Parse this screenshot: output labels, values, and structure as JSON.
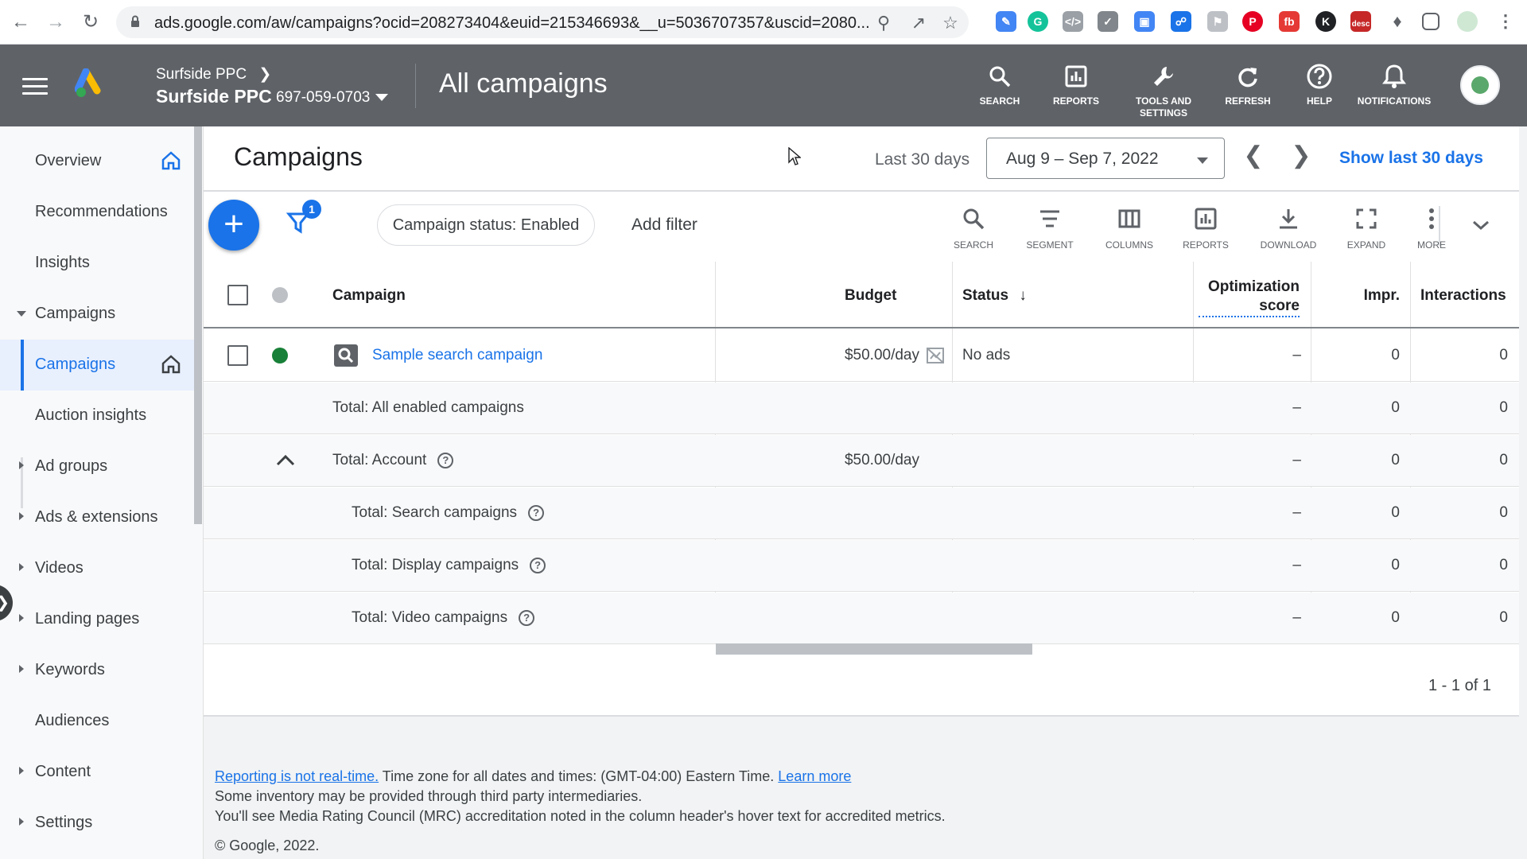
{
  "browser": {
    "url": "ads.google.com/aw/campaigns?ocid=208273404&euid=215346693&__u=5036707357&uscid=2080...",
    "extension_badge": "desc"
  },
  "header": {
    "account_breadcrumb": "Surfside PPC",
    "account_name": "Surfside PPC",
    "account_id": "697-059-0703",
    "page_title": "All campaigns",
    "tools": [
      {
        "icon": "search-icon",
        "label": "SEARCH"
      },
      {
        "icon": "reports-icon",
        "label": "REPORTS"
      },
      {
        "icon": "wrench-icon",
        "label": "TOOLS AND SETTINGS"
      },
      {
        "icon": "refresh-icon",
        "label": "REFRESH"
      },
      {
        "icon": "help-icon",
        "label": "HELP"
      },
      {
        "icon": "bell-icon",
        "label": "NOTIFICATIONS"
      }
    ]
  },
  "sidebar": {
    "items": [
      {
        "label": "Overview"
      },
      {
        "label": "Recommendations"
      },
      {
        "label": "Insights"
      },
      {
        "label": "Campaigns"
      },
      {
        "label": "Campaigns"
      },
      {
        "label": "Auction insights"
      },
      {
        "label": "Ad groups"
      },
      {
        "label": "Ads & extensions"
      },
      {
        "label": "Videos"
      },
      {
        "label": "Landing pages"
      },
      {
        "label": "Keywords"
      },
      {
        "label": "Audiences"
      },
      {
        "label": "Content"
      },
      {
        "label": "Settings"
      }
    ]
  },
  "main": {
    "title": "Campaigns",
    "date_range_label": "Last 30 days",
    "date_range_value": "Aug 9 – Sep 7, 2022",
    "show_last_link": "Show last 30 days",
    "filter_count": "1",
    "filter_chip": "Campaign status: Enabled",
    "add_filter": "Add filter",
    "toolbar": [
      {
        "icon": "search-icon",
        "label": "SEARCH"
      },
      {
        "icon": "segment-icon",
        "label": "SEGMENT"
      },
      {
        "icon": "columns-icon",
        "label": "COLUMNS"
      },
      {
        "icon": "reports-icon",
        "label": "REPORTS"
      },
      {
        "icon": "download-icon",
        "label": "DOWNLOAD"
      },
      {
        "icon": "expand-icon",
        "label": "EXPAND"
      },
      {
        "icon": "more-icon",
        "label": "MORE"
      }
    ],
    "table": {
      "headers": {
        "campaign": "Campaign",
        "budget": "Budget",
        "status": "Status",
        "optimization_line1": "Optimization",
        "optimization_line2": "score",
        "impr": "Impr.",
        "interactions": "Interactions"
      },
      "rows": [
        {
          "campaign": "Sample search campaign",
          "budget": "$50.00/day",
          "status": "No ads",
          "opt": "–",
          "impr": "0",
          "interactions": "0"
        },
        {
          "campaign": "Total: All enabled campaigns",
          "budget": "",
          "status": "",
          "opt": "–",
          "impr": "0",
          "interactions": "0"
        },
        {
          "campaign": "Total: Account",
          "budget": "$50.00/day",
          "status": "",
          "opt": "–",
          "impr": "0",
          "interactions": "0"
        },
        {
          "campaign": "Total: Search campaigns",
          "budget": "",
          "status": "",
          "opt": "–",
          "impr": "0",
          "interactions": "0"
        },
        {
          "campaign": "Total: Display campaigns",
          "budget": "",
          "status": "",
          "opt": "–",
          "impr": "0",
          "interactions": "0"
        },
        {
          "campaign": "Total: Video campaigns",
          "budget": "",
          "status": "",
          "opt": "–",
          "impr": "0",
          "interactions": "0"
        }
      ],
      "pagination": "1 - 1 of 1"
    }
  },
  "footer": {
    "reporting_link": "Reporting is not real-time.",
    "timezone_text": " Time zone for all dates and times: (GMT-04:00) Eastern Time. ",
    "learn_more": "Learn more",
    "line2": "Some inventory may be provided through third party intermediaries.",
    "line3": "You'll see Media Rating Council (MRC) accreditation noted in the column header's hover text for accredited metrics.",
    "copyright": "© Google, 2022."
  },
  "colors": {
    "header_bg": "#5f6368",
    "accent_blue": "#1a73e8",
    "status_enabled": "#188038"
  }
}
